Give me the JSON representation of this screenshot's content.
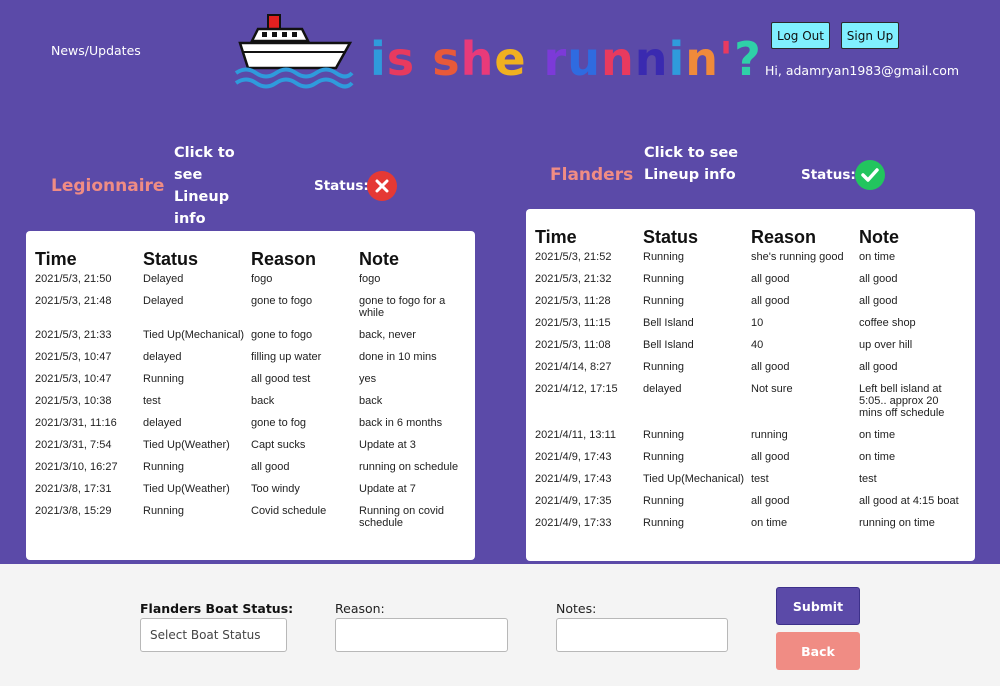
{
  "nav": {
    "news_label": "News/Updates"
  },
  "logo": {
    "chars": [
      {
        "c": "i",
        "color": "#2f9bdc"
      },
      {
        "c": "s",
        "color": "#e83a5f"
      },
      {
        "c": " ",
        "color": "#fff"
      },
      {
        "c": "s",
        "color": "#e8593a"
      },
      {
        "c": "h",
        "color": "#e83a7a"
      },
      {
        "c": "e",
        "color": "#f0b020"
      },
      {
        "c": " ",
        "color": "#fff"
      },
      {
        "c": "r",
        "color": "#7c3ad8"
      },
      {
        "c": "u",
        "color": "#2f6be0"
      },
      {
        "c": "n",
        "color": "#e83a5f"
      },
      {
        "c": "n",
        "color": "#3a2ab0"
      },
      {
        "c": "i",
        "color": "#2f9bdc"
      },
      {
        "c": "n",
        "color": "#f08a3a"
      },
      {
        "c": "'",
        "color": "#e83a5f"
      },
      {
        "c": "?",
        "color": "#2fd0a8"
      }
    ]
  },
  "auth": {
    "logout_label": "Log Out",
    "signup_label": "Sign Up",
    "greeting": "Hi, adamryan1983@gmail.com"
  },
  "colors": {
    "background": "#5b4aa8",
    "accent": "#80f0ff",
    "boat_name": "#f08c84",
    "status_ok": "#22c55e",
    "status_bad": "#e53935",
    "submit": "#5b4aa8",
    "back": "#f08c84"
  },
  "legionnaire": {
    "name": "Legionnaire",
    "lineup_link": "Click to see Lineup info",
    "status_label": "Status:",
    "status_icon": "x-circle-icon",
    "headers": [
      "Time",
      "Status",
      "Reason",
      "Note"
    ],
    "rows": [
      [
        "2021/5/3, 21:50",
        "Delayed",
        "fogo",
        "fogo"
      ],
      [
        "2021/5/3, 21:48",
        "Delayed",
        "gone to fogo",
        "gone to fogo for a while"
      ],
      [
        "2021/5/3, 21:33",
        "Tied Up(Mechanical)",
        "gone to fogo",
        "back, never"
      ],
      [
        "2021/5/3, 10:47",
        "delayed",
        "filling up water",
        "done in 10 mins"
      ],
      [
        "2021/5/3, 10:47",
        "Running",
        "all good test",
        "yes"
      ],
      [
        "2021/5/3, 10:38",
        "test",
        "back",
        "back"
      ],
      [
        "2021/3/31, 11:16",
        "delayed",
        "gone to fog",
        "back in 6 months"
      ],
      [
        "2021/3/31, 7:54",
        "Tied Up(Weather)",
        "Capt sucks",
        "Update at 3"
      ],
      [
        "2021/3/10, 16:27",
        "Running",
        "all good",
        "running on schedule"
      ],
      [
        "2021/3/8, 17:31",
        "Tied Up(Weather)",
        "Too windy",
        "Update at 7"
      ],
      [
        "2021/3/8, 15:29",
        "Running",
        "Covid schedule",
        "Running on covid schedule"
      ]
    ]
  },
  "flanders": {
    "name": "Flanders",
    "lineup_link": "Click to see Lineup info",
    "status_label": "Status:",
    "status_icon": "check-circle-icon",
    "headers": [
      "Time",
      "Status",
      "Reason",
      "Note"
    ],
    "rows": [
      [
        "2021/5/3, 21:52",
        "Running",
        "she's running good",
        "on time"
      ],
      [
        "2021/5/3, 21:32",
        "Running",
        "all good",
        "all good"
      ],
      [
        "2021/5/3, 11:28",
        "Running",
        "all good",
        "all good"
      ],
      [
        "2021/5/3, 11:15",
        "Bell Island",
        "10",
        "coffee shop"
      ],
      [
        "2021/5/3, 11:08",
        "Bell Island",
        "40",
        "up over hill"
      ],
      [
        "2021/4/14, 8:27",
        "Running",
        "all good",
        "all good"
      ],
      [
        "2021/4/12, 17:15",
        "delayed",
        "Not sure",
        "Left bell island at 5:05.. approx 20 mins off schedule"
      ],
      [
        "2021/4/11, 13:11",
        "Running",
        "running",
        "on time"
      ],
      [
        "2021/4/9, 17:43",
        "Running",
        "all good",
        "on time"
      ],
      [
        "2021/4/9, 17:43",
        "Tied Up(Mechanical)",
        "test",
        "test"
      ],
      [
        "2021/4/9, 17:35",
        "Running",
        "all good",
        "all good at 4:15 boat"
      ],
      [
        "2021/4/9, 17:33",
        "Running",
        "on time",
        "running on time"
      ]
    ]
  },
  "form": {
    "boat_status_label": "Flanders Boat Status:",
    "boat_status_placeholder": "Select Boat Status",
    "reason_label": "Reason:",
    "notes_label": "Notes:",
    "submit_label": "Submit",
    "back_label": "Back"
  }
}
